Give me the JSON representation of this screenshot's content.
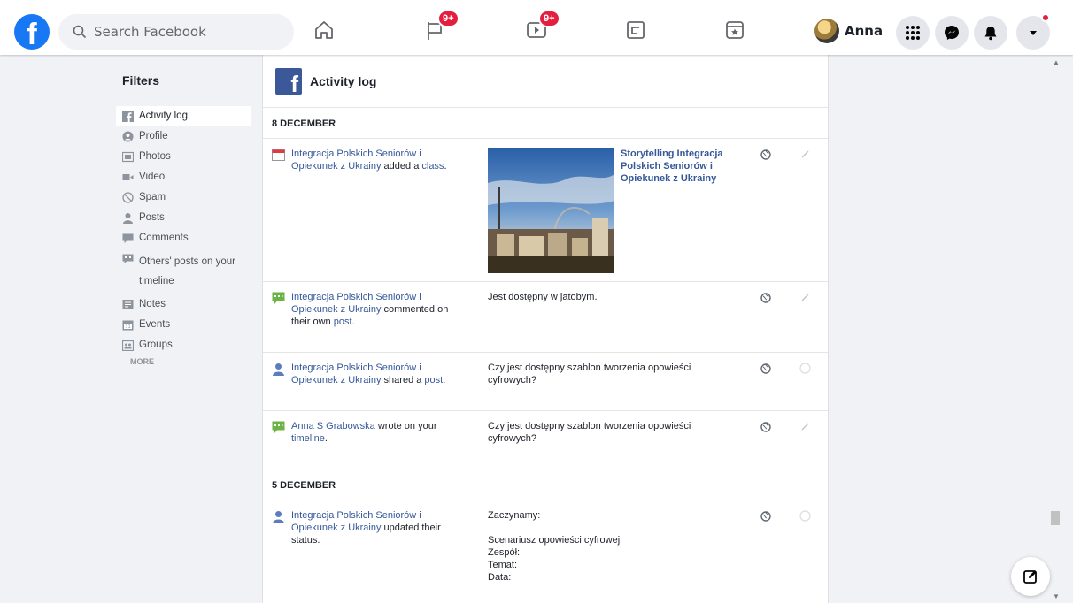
{
  "topbar": {
    "logo_letter": "f",
    "search_placeholder": "Search Facebook",
    "nav": [
      {
        "name": "home",
        "badge": ""
      },
      {
        "name": "pages",
        "badge": "9+"
      },
      {
        "name": "watch",
        "badge": "9+"
      },
      {
        "name": "groups",
        "badge": ""
      },
      {
        "name": "gaming",
        "badge": ""
      }
    ],
    "profile_name": "Anna",
    "accent": "#1877f2",
    "badge_color": "#e41e3f"
  },
  "sidebar": {
    "title": "Filters",
    "items": [
      {
        "label": "Activity log",
        "icon": "facebook-icon"
      },
      {
        "label": "Profile",
        "icon": "profile-icon"
      },
      {
        "label": "Photos",
        "icon": "photos-icon"
      },
      {
        "label": "Video",
        "icon": "video-icon"
      },
      {
        "label": "Spam",
        "icon": "spam-icon"
      },
      {
        "label": "Posts",
        "icon": "posts-icon"
      },
      {
        "label": "Comments",
        "icon": "comments-icon"
      },
      {
        "label": "Others' posts on your timeline",
        "icon": "others-posts-icon"
      },
      {
        "label": "Notes",
        "icon": "notes-icon"
      },
      {
        "label": "Events",
        "icon": "events-icon"
      },
      {
        "label": "Groups",
        "icon": "groups-icon"
      }
    ],
    "more": "MORE"
  },
  "main": {
    "title": "Activity log",
    "sections": [
      {
        "date": "8 DECEMBER",
        "entries": [
          {
            "icon": "calendar-icon",
            "actor": "Integracja Polskich Seniorów i Opiekunek z Ukrainy",
            "verb": " added a ",
            "object": "class",
            "tail": ".",
            "content": "",
            "photo_title": "Storytelling Integracja Polskich Seniorów i Opiekunek z Ukrainy",
            "action": "pencil-icon"
          },
          {
            "icon": "comment-icon",
            "actor": "Integracja Polskich Seniorów i Opiekunek z Ukrainy",
            "verb": " commented on their own ",
            "object": "post",
            "tail": ".",
            "content": "Jest dostępny w jatobym.",
            "action": "pencil-icon"
          },
          {
            "icon": "person-icon",
            "actor": "Integracja Polskich Seniorów i Opiekunek z Ukrainy",
            "verb": " shared a ",
            "object": "post",
            "tail": ".",
            "content": "Czy jest dostępny szablon tworzenia opowieści cyfrowych?",
            "action": "circle-icon"
          },
          {
            "icon": "comment-icon",
            "actor": "Anna S Grabowska",
            "verb": " wrote on your ",
            "object": "timeline",
            "tail": ".",
            "content": "Czy jest dostępny szablon tworzenia opowieści cyfrowych?",
            "action": "pencil-icon"
          }
        ]
      },
      {
        "date": "5 DECEMBER",
        "entries": [
          {
            "icon": "person-icon",
            "actor": "Integracja Polskich Seniorów i Opiekunek z Ukrainy",
            "verb": " updated their status",
            "object": "",
            "tail": ".",
            "content": "Zaczynamy:\n\nScenariusz opowieści cyfrowej\nZespół:\nTemat:\nData:",
            "action": "circle-icon"
          }
        ]
      }
    ]
  }
}
